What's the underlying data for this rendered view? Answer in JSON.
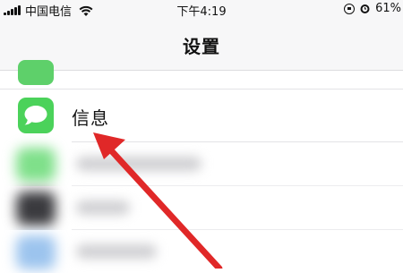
{
  "status_bar": {
    "carrier": "中国电信",
    "time": "下午4:19",
    "battery": "61%"
  },
  "nav": {
    "title": "设置"
  },
  "list": {
    "items": [
      {
        "label": "信息",
        "icon": "messages-icon",
        "icon_color": "#4bd25a"
      }
    ]
  },
  "colors": {
    "accent_green": "#4bd25a",
    "arrow_red": "#e02828"
  }
}
